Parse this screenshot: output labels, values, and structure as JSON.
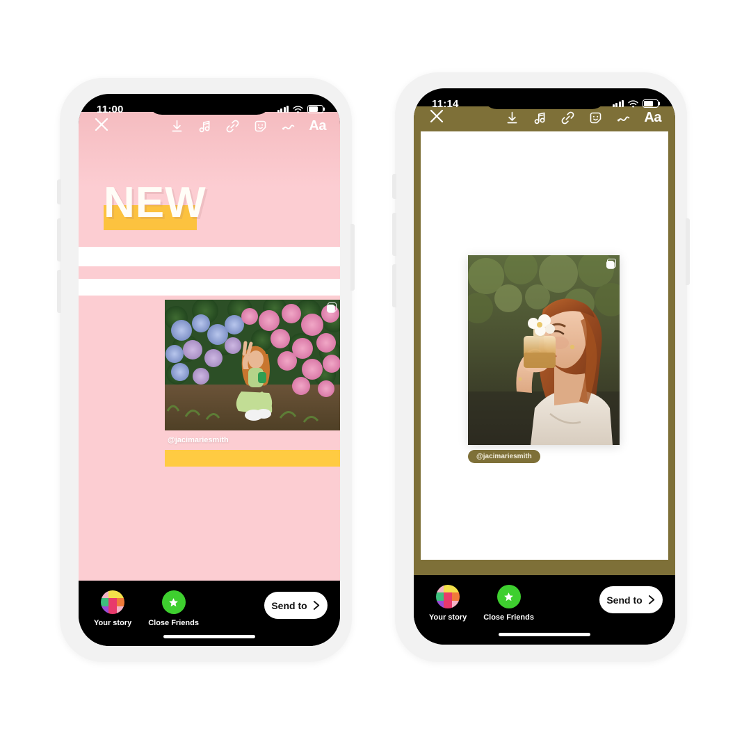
{
  "page": {
    "background": "#ffffff",
    "description": "Two iPhone mockups showing an Instagram Story editor screen side by side"
  },
  "phones": [
    {
      "id": "phone-left",
      "status_bar": {
        "time": "11:00",
        "signal_icon": "cellular-signal-icon",
        "wifi_icon": "wifi-icon",
        "battery_icon": "battery-icon"
      },
      "toolbar": {
        "close_label": "✕",
        "items": [
          {
            "name": "save-icon",
            "label": "Save"
          },
          {
            "name": "music-icon",
            "label": "Music"
          },
          {
            "name": "link-icon",
            "label": "Link"
          },
          {
            "name": "sticker-icon",
            "label": "Stickers"
          },
          {
            "name": "draw-icon",
            "label": "Draw"
          },
          {
            "name": "text-icon",
            "label": "Aa"
          }
        ]
      },
      "canvas": {
        "background_color": "#fccdd2",
        "heading": "NEW",
        "heading_color": "#fffdf7",
        "highlight_color": "#fcc23f",
        "stripe_color": "#ffffff",
        "accent_bar_color": "#ffcb42",
        "photo": {
          "alt": "Woman in green outfit sitting cross-legged in front of blue and pink hydrangeas making a peace sign",
          "carousel_icon": "carousel-icon"
        },
        "handle": "@jacimariesmith"
      },
      "bottom_bar": {
        "destinations": [
          {
            "name": "your-story",
            "label": "Your story",
            "avatar": "story-grid-avatar"
          },
          {
            "name": "close-friends",
            "label": "Close Friends",
            "avatar": "green-star-avatar",
            "color": "#3ecf2f"
          }
        ],
        "send_button": {
          "label": "Send to",
          "chevron": "chevron-right-icon"
        }
      }
    },
    {
      "id": "phone-right",
      "status_bar": {
        "time": "11:14",
        "signal_icon": "cellular-signal-icon",
        "wifi_icon": "wifi-icon",
        "battery_icon": "battery-icon"
      },
      "toolbar": {
        "close_label": "✕",
        "items": [
          {
            "name": "save-icon",
            "label": "Save"
          },
          {
            "name": "music-icon",
            "label": "Music"
          },
          {
            "name": "link-icon",
            "label": "Link"
          },
          {
            "name": "sticker-icon",
            "label": "Stickers"
          },
          {
            "name": "draw-icon",
            "label": "Draw"
          },
          {
            "name": "text-icon",
            "label": "Aa"
          }
        ]
      },
      "canvas": {
        "background_color": "#7e7038",
        "card_color": "#ffffff",
        "photo": {
          "alt": "Woman with auburn hair smelling a perfume bottle topped with white flowers, green foliage background",
          "carousel_icon": "carousel-icon"
        },
        "handle": "@jacimariesmith",
        "handle_pill_color": "#7e7038",
        "handle_text_color": "#f2eddc"
      },
      "bottom_bar": {
        "destinations": [
          {
            "name": "your-story",
            "label": "Your story",
            "avatar": "story-grid-avatar"
          },
          {
            "name": "close-friends",
            "label": "Close Friends",
            "avatar": "green-star-avatar",
            "color": "#3ecf2f"
          }
        ],
        "send_button": {
          "label": "Send to",
          "chevron": "chevron-right-icon"
        }
      }
    }
  ]
}
